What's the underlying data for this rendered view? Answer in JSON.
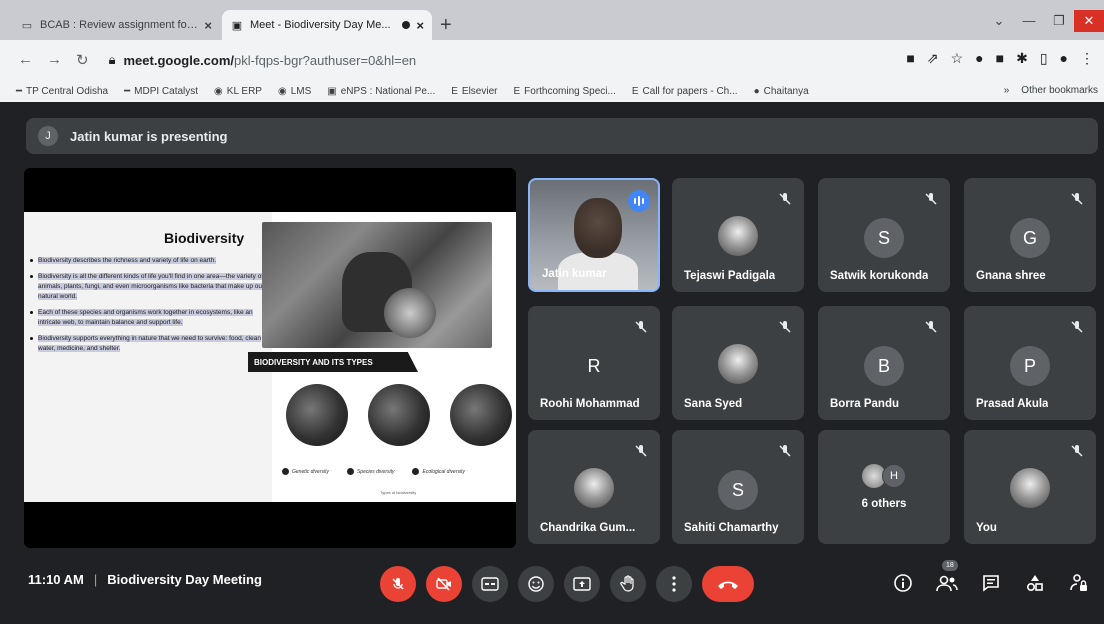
{
  "browser": {
    "tabs": [
      {
        "title": "BCAB : Review assignment for B...",
        "active": false
      },
      {
        "title": "Meet - Biodiversity Day Me...",
        "active": true
      }
    ],
    "url_main": "meet.google.com/",
    "url_rest": "pkl-fqps-bgr?authuser=0&hl=en",
    "bookmarks": [
      "TP Central Odisha",
      "MDPI Catalyst",
      "KL ERP",
      "LMS",
      "eNPS : National Pe...",
      "Elsevier",
      "Forthcoming Speci...",
      "Call for papers - Ch...",
      "Chaitanya"
    ],
    "other_bookmarks": "Other bookmarks"
  },
  "meet": {
    "presenting_initial": "J",
    "presenting_text": "Jatin kumar is presenting",
    "slide": {
      "title": "Biodiversity",
      "bullets": [
        "Biodiversity describes the richness and variety of life on earth.",
        "Biodiversity is all the different kinds of life you'll find in one area—the variety of animals, plants, fungi, and even microorganisms like bacteria that make up our natural world.",
        "Each of these species and organisms work together in ecosystems, like an intricate web, to maintain balance and support life.",
        "Biodiversity supports everything in nature that we need to survive: food, clean water, medicine, and shelter."
      ],
      "types_title": "BIODIVERSITY AND ITS TYPES",
      "legend": [
        "Genetic diversity",
        "Species diversity",
        "Ecological diversity"
      ],
      "footer": "Types of biodiversity"
    },
    "tiles": [
      {
        "name": "Jatin kumar",
        "kind": "video"
      },
      {
        "name": "Tejaswi Padigala",
        "kind": "photo"
      },
      {
        "name": "Satwik korukonda",
        "kind": "letter",
        "letter": "S"
      },
      {
        "name": "Gnana shree",
        "kind": "letter",
        "letter": "G"
      },
      {
        "name": "Roohi Mohammad",
        "kind": "letter",
        "letter": "R"
      },
      {
        "name": "Sana Syed",
        "kind": "photo"
      },
      {
        "name": "Borra Pandu",
        "kind": "letter",
        "letter": "B"
      },
      {
        "name": "Prasad Akula",
        "kind": "letter",
        "letter": "P"
      },
      {
        "name": "Chandrika Gum...",
        "kind": "photo"
      },
      {
        "name": "Sahiti Chamarthy",
        "kind": "letter",
        "letter": "S"
      },
      {
        "name": "6 others",
        "kind": "others",
        "letter": "H"
      },
      {
        "name": "You",
        "kind": "photo"
      }
    ],
    "time": "11:10 AM",
    "meeting_title": "Biodiversity Day Meeting",
    "participants_count": "18",
    "colors": {
      "accent_red": "#ea4335",
      "surface": "#3c4043",
      "background": "#202124",
      "speaking": "#4285f4"
    }
  }
}
